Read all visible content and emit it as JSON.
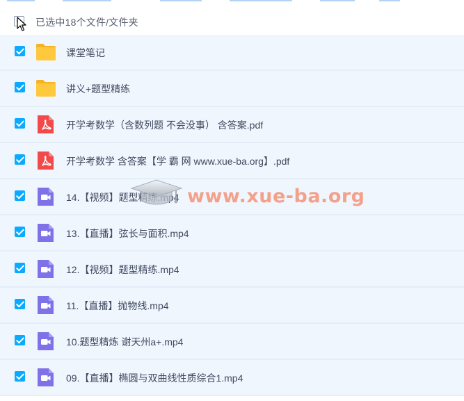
{
  "header": {
    "selection_text": "已选中18个文件/文件夹"
  },
  "colors": {
    "accent": "#09aaff",
    "row_selected_bg": "#f0f6fe",
    "folder": "#ffc83d",
    "pdf": "#f24a4a",
    "video": "#7f72e8",
    "watermark": "#f58a6c"
  },
  "files": [
    {
      "name": "课堂笔记",
      "icon": "folder-icon",
      "selected": true
    },
    {
      "name": "讲义+题型精练",
      "icon": "folder-icon",
      "selected": true
    },
    {
      "name": "开学考数学（含数列题 不会没事） 含答案.pdf",
      "icon": "pdf-icon",
      "selected": true
    },
    {
      "name": "开学考数学 含答案【学 霸 网 www.xue-ba.org】.pdf",
      "icon": "pdf-icon",
      "selected": true
    },
    {
      "name": "14.【视频】题型精练.mp4",
      "icon": "video-icon",
      "selected": true
    },
    {
      "name": "13.【直播】弦长与面积.mp4",
      "icon": "video-icon",
      "selected": true
    },
    {
      "name": "12.【视频】题型精练.mp4",
      "icon": "video-icon",
      "selected": true
    },
    {
      "name": "11.【直播】抛物线.mp4",
      "icon": "video-icon",
      "selected": true
    },
    {
      "name": "10.题型精炼 谢天州a+.mp4",
      "icon": "video-icon",
      "selected": true
    },
    {
      "name": "09.【直播】椭圆与双曲线性质综合1.mp4",
      "icon": "video-icon",
      "selected": true
    }
  ],
  "watermark": {
    "text": "www.xue-ba.org",
    "logo": "graduation-cap-icon"
  }
}
